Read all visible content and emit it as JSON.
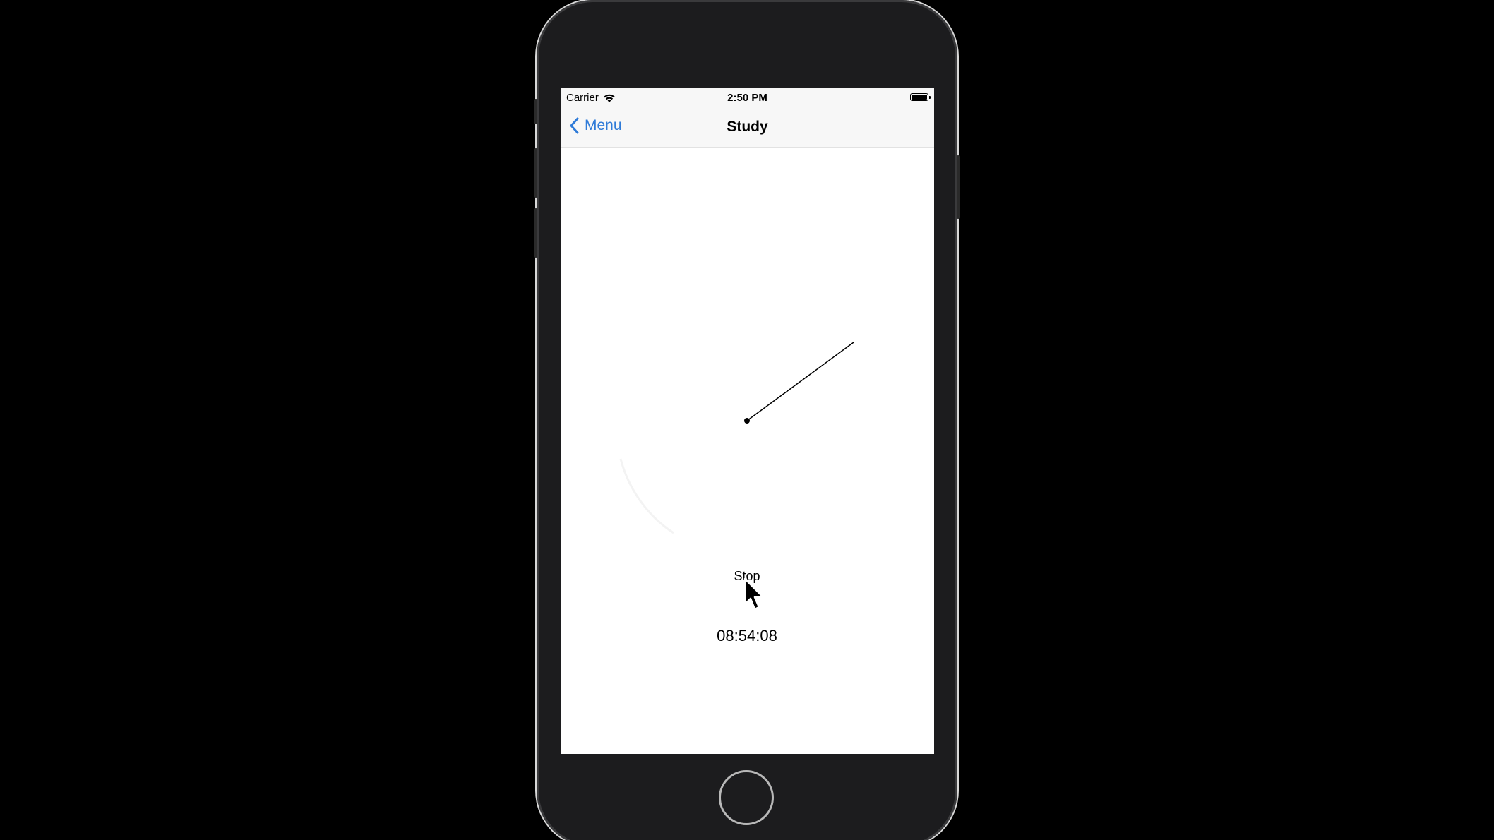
{
  "status_bar": {
    "carrier": "Carrier",
    "time": "2:50 PM",
    "wifi_icon": "wifi-icon",
    "battery_icon": "battery-icon"
  },
  "nav": {
    "back_label": "Menu",
    "back_icon": "chevron-left-icon",
    "title": "Study"
  },
  "main": {
    "stop_label": "Stop",
    "timer_value": "08:54:08"
  },
  "colors": {
    "accent": "#2f7bd8",
    "background": "#ffffff",
    "bezel": "#1c1c1e"
  }
}
